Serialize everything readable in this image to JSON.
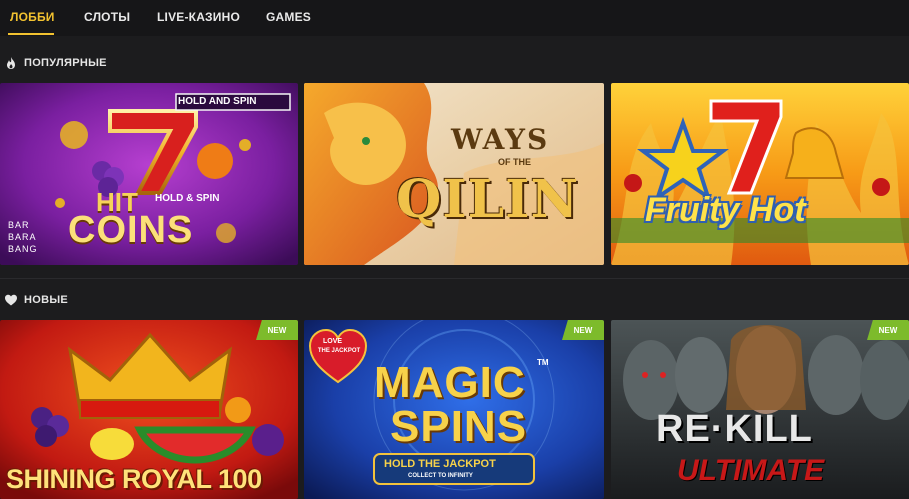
{
  "nav": {
    "items": [
      {
        "label": "ЛОББИ",
        "active": true
      },
      {
        "label": "СЛОТЫ",
        "active": false
      },
      {
        "label": "LIVE-КАЗИНО",
        "active": false
      },
      {
        "label": "GAMES",
        "active": false
      }
    ],
    "accent": "#f2c230"
  },
  "sections": [
    {
      "title": "ПОПУЛЯРНЫЕ",
      "icon": "fire-icon",
      "games": [
        {
          "title_line1": "HIT",
          "title_line2": "COINS",
          "tag": "HOLD AND SPIN",
          "sub": "HOLD & SPIN",
          "provider": "BAR BARA BANG"
        },
        {
          "title_line1": "WAYS",
          "title_small": "OF THE",
          "title_line2": "QILIN"
        },
        {
          "title_line1": "Fruity Hot"
        }
      ]
    },
    {
      "title": "НОВЫЕ",
      "icon": "heart-icon",
      "badge": "NEW",
      "badge_color": "#7dbb2b",
      "games": [
        {
          "title_line1": "SHINING ROYAL 100"
        },
        {
          "title_line1": "MAGIC",
          "title_line2": "SPINS",
          "tm": "TM",
          "heart_line1": "LOVE",
          "heart_line2": "THE JACKPOT",
          "banner": "HOLD THE JACKPOT",
          "banner_sub": "COLLECT TO INFINITY"
        },
        {
          "title_line1": "RE·KILL",
          "title_line2": "ULTIMATE"
        }
      ]
    }
  ]
}
